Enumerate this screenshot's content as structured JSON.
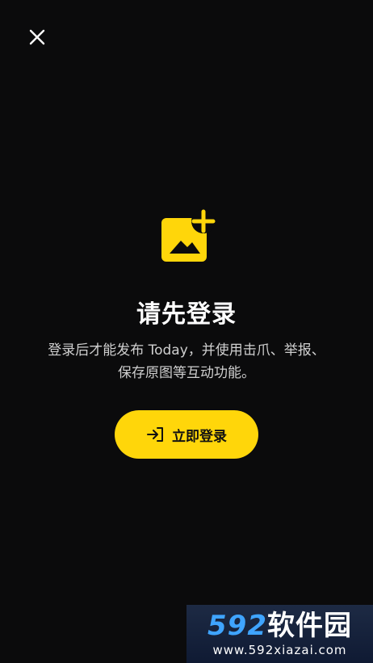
{
  "close_icon": "close-icon",
  "hero_icon": "add-image-icon",
  "colors": {
    "background": "#0b0b0c",
    "accent": "#ffd60a"
  },
  "prompt": {
    "title": "请先登录",
    "desc_line1": "登录后才能发布 Today，并使用击爪、举报、",
    "desc_line2": "保存原图等互动功能。"
  },
  "login_button": {
    "icon": "login-arrow-icon",
    "label": "立即登录"
  },
  "watermark": {
    "brand_num": "592",
    "brand_cn": "软件园",
    "url": "www.592xiazai.com"
  }
}
